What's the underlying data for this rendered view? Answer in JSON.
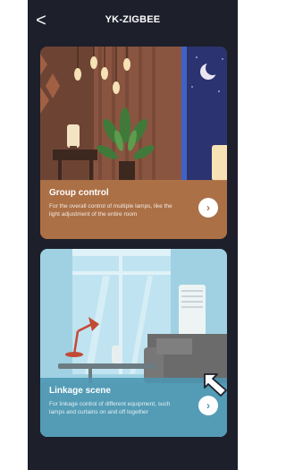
{
  "header": {
    "title": "YK-ZIGBEE",
    "back_glyph": "<"
  },
  "cards": [
    {
      "title": "Group control",
      "description": "For the overall control of multiple lamps, like the light adjustment of the entire room",
      "arrow_glyph": "›",
      "icon": "chevron-right-icon",
      "accent": "#b07348"
    },
    {
      "title": "Linkage scene",
      "description": "For linkage control of different equipment, such lamps and curtains on and off together",
      "arrow_glyph": "›",
      "icon": "chevron-right-icon",
      "accent": "#4c96b2"
    }
  ],
  "colors": {
    "screen_background": "#1d1f2b",
    "text": "#ffffff"
  }
}
